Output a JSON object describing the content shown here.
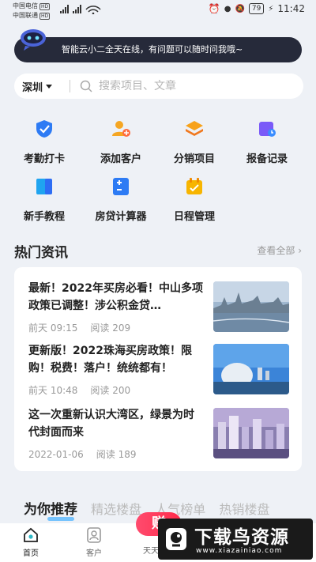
{
  "status_bar": {
    "carrier1": "中国电信",
    "carrier2": "中国联通",
    "hd": "HD",
    "signal": "⁴⁶ᴵ ⁴⁶ᴵ",
    "battery": "79",
    "time": "11:42"
  },
  "assistant": {
    "message": "智能云小二全天在线，有问题可以随时问我哦~"
  },
  "search": {
    "city": "深圳",
    "placeholder": "搜索项目、文章"
  },
  "quick_actions": [
    {
      "label": "考勤打卡",
      "icon": "check-shield-icon",
      "color": "#2d7bf4"
    },
    {
      "label": "添加客户",
      "icon": "add-user-icon",
      "color": "#f5a623"
    },
    {
      "label": "分销项目",
      "icon": "layers-icon",
      "color": "#f0781e"
    },
    {
      "label": "报备记录",
      "icon": "record-icon",
      "color": "#7a5af8"
    },
    {
      "label": "新手教程",
      "icon": "tutorial-icon",
      "color": "#1fa4f0"
    },
    {
      "label": "房贷计算器",
      "icon": "calculator-icon",
      "color": "#2d7bf4"
    },
    {
      "label": "日程管理",
      "icon": "calendar-icon",
      "color": "#f7b500"
    }
  ],
  "news_section": {
    "title": "热门资讯",
    "view_all": "查看全部 ›",
    "items": [
      {
        "title": "最新！2022年买房必看！中山多项政策已调整！涉公积金贷…",
        "date": "前天 09:15",
        "reads": "阅读 209"
      },
      {
        "title": "更新版！2022珠海买房政策！限购！税费！落户！统统都有！",
        "date": "前天 10:48",
        "reads": "阅读 200"
      },
      {
        "title": "这一次重新认识大湾区，绿景为时代封面而来",
        "date": "2022-01-06",
        "reads": "阅读 189"
      }
    ]
  },
  "recommend_tabs": {
    "active": "为你推荐",
    "others": [
      "精选楼盘",
      "人气榜单",
      "热销楼盘"
    ]
  },
  "bottom_nav": {
    "home": "首页",
    "customers": "客户",
    "earn": "赚",
    "third": "天天"
  },
  "watermark": {
    "title": "下载鸟资源",
    "url": "www.xiazainiao.com"
  }
}
